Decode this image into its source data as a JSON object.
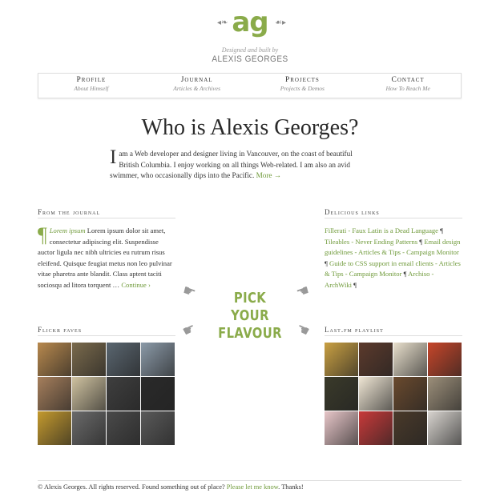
{
  "logo": {
    "mark": "ag",
    "byline": "Designed and built by",
    "name": "ALEXIS GEORGES"
  },
  "nav": [
    {
      "title": "Profile",
      "sub": "About Himself"
    },
    {
      "title": "Journal",
      "sub": "Articles & Archives"
    },
    {
      "title": "Projects",
      "sub": "Projects & Demos"
    },
    {
      "title": "Contact",
      "sub": "How To Reach Me"
    }
  ],
  "headline": "Who is Alexis Georges?",
  "intro": {
    "dropcap": "I",
    "text": " am a Web developer and designer living in Vancouver, on the coast of beautiful British Columbia. I enjoy working on all things Web-related. I am also an avid swimmer, who occasionally dips into the Pacific. ",
    "more": "More →"
  },
  "journal": {
    "heading": "From the journal",
    "pilcrow": "¶",
    "lead": "Lorem ipsum",
    "text": " Lorem ipsum dolor sit amet, consectetur adipiscing elit. Suspendisse auctor ligula nec nibh ultricies eu rutrum risus eleifend. Quisque feugiat metus non leo pulvinar vitae pharetra ante blandit. Class aptent taciti sociosqu ad litora torquent … ",
    "continue": "Continue ›"
  },
  "delicious": {
    "heading": "Delicious links",
    "links": [
      "Fillerati - Faux Latin is a Dead Language",
      "Tileables - Never Ending Patterns",
      "Email design guidelines - Articles & Tips - Campaign Monitor",
      "Guide to CSS support in email clients - Articles & Tips - Campaign Monitor",
      "Archiso - ArchWiki"
    ],
    "separator": " ¶ "
  },
  "pick": {
    "line1": "PICK YOUR",
    "line2": "FLAVOUR"
  },
  "flickr": {
    "heading": "Flickr faves",
    "tiles": [
      "#b8894e",
      "#7a6a4c",
      "#5a6670",
      "#8b9aa8",
      "#a67f5c",
      "#cfc2a0",
      "#3f3f3f",
      "#2a2a2a",
      "#c49a2e",
      "#6a6a6a",
      "#4a4a4a",
      "#5a5a5a"
    ]
  },
  "lastfm": {
    "heading": "Last.fm playlist",
    "tiles": [
      "#c9a043",
      "#5c3a2c",
      "#e8dfcc",
      "#c7462a",
      "#3a3a2a",
      "#efe6d4",
      "#6a4a2e",
      "#9c8f7a",
      "#e7c6c8",
      "#c83a3a",
      "#4a3a2a",
      "#d8d4cf"
    ]
  },
  "footer": {
    "text": "© Alexis Georges. All rights reserved. Found something out of place? ",
    "link": "Please let me know",
    "thanks": ". Thanks!"
  }
}
